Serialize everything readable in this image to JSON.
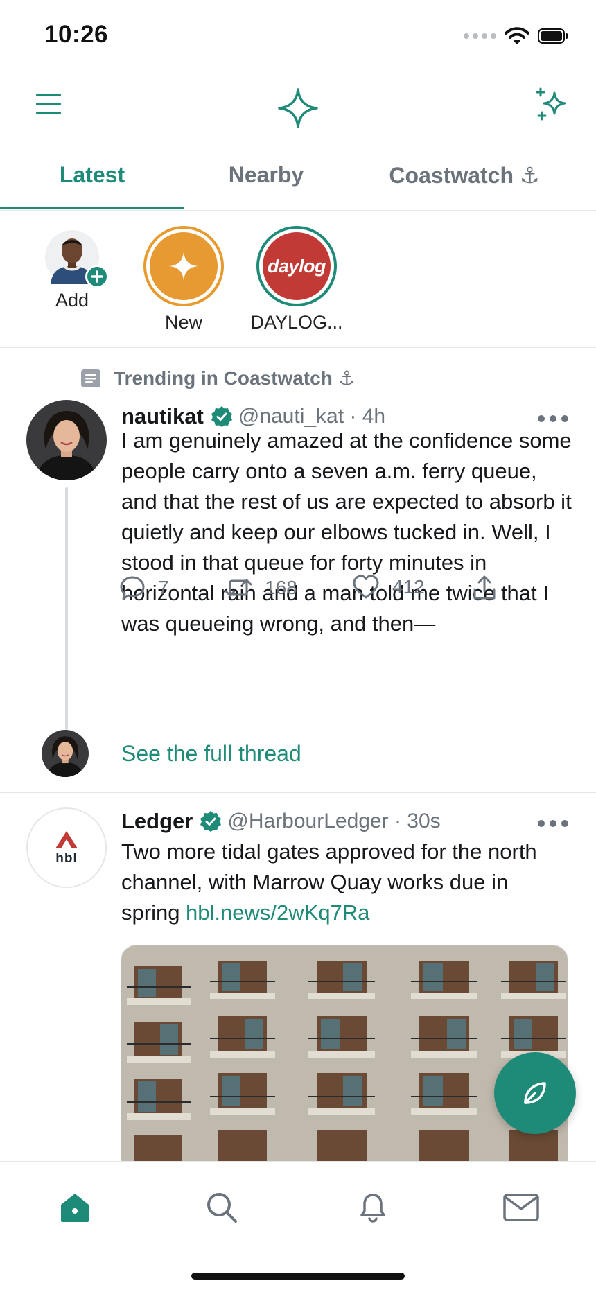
{
  "status_bar": {
    "time": "10:26",
    "icons": [
      "signal-dots-icon",
      "wifi-icon",
      "battery-icon"
    ]
  },
  "top_bar": {
    "icons": [
      "menu-icon",
      "app-logo-sparkle-icon",
      "sparkles-icon"
    ]
  },
  "tabs": [
    {
      "label": "Latest",
      "active": true
    },
    {
      "label": "Nearby",
      "active": false
    },
    {
      "label": "Coastwatch ⚓",
      "active": false
    }
  ],
  "stories": {
    "add_label": "Add",
    "new_label": "New",
    "daylog_label": "DAYLOG...",
    "daylog_logo_text": "daylog"
  },
  "posts": [
    {
      "context": "Trending in Coastwatch ⚓",
      "name": "nautikat",
      "verified": true,
      "handle": "@nauti_kat · 4h",
      "body": "I am genuinely amazed at the confidence some people carry onto a seven a.m. ferry queue, and that the rest of us are expected to absorb it quietly and keep our elbows tucked in. Well, I stood in that queue for forty minutes in horizontal rain and a man told me twice that I was queueing wrong, and then—",
      "replies": "7",
      "reposts": "168",
      "likes": "412",
      "thread_link": "See the full thread"
    },
    {
      "name": "Ledger",
      "verified": true,
      "handle": "@HarbourLedger · 30s",
      "avatar_text": "hbl",
      "body": "Two more tidal gates approved for the north channel, with Marrow Quay works due in spring ",
      "link": "hbl.news/2wKq7Ra",
      "media": "apartment-building-balconies-photo"
    }
  ],
  "bottom_nav": [
    "home-icon",
    "search-icon",
    "bell-icon",
    "mail-icon"
  ],
  "colors": {
    "accent": "#1e8a78",
    "muted": "#6b737c",
    "story_new": "#e79a31",
    "daylog_red": "#c23a36"
  }
}
